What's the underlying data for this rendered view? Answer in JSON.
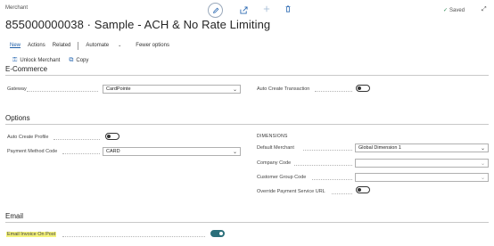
{
  "header": {
    "breadcrumb": "Merchant",
    "title": "855000000038 · Sample - ACH & No Rate Limiting",
    "saved_label": "Saved"
  },
  "icons": {
    "edit": "pencil-icon",
    "share": "share-icon",
    "add": "plus-icon",
    "delete": "trash-icon",
    "saved": "check-icon",
    "expand": "expand-icon"
  },
  "actionbar": {
    "new": "New",
    "actions": "Actions",
    "related": "Related",
    "automate": "Automate",
    "fewer_options": "Fewer options"
  },
  "subactions": {
    "unlock": "Unlock Merchant",
    "copy": "Copy"
  },
  "ecommerce": {
    "title": "E-Commerce",
    "gateway_label": "Gateway",
    "gateway_value": "CardPointe",
    "auto_create_label": "Auto Create Transaction",
    "auto_create_on": false
  },
  "options": {
    "title": "Options",
    "auto_create_profile_label": "Auto Create Profile",
    "auto_create_profile_on": false,
    "payment_method_label": "Payment Method Code",
    "payment_method_value": "CARD",
    "dimensions_title": "DIMENSIONS",
    "default_merchant_label": "Default Merchant",
    "default_merchant_value": "Global Dimension 1",
    "company_code_label": "Company Code",
    "company_code_value": "",
    "customer_group_label": "Customer Group Code",
    "customer_group_value": "",
    "override_label": "Override Payment Service URL",
    "override_on": false
  },
  "email": {
    "title": "Email",
    "invoice_label": "Email Invoice On Post",
    "invoice_on": true
  },
  "colors": {
    "accent": "#2f6cb3",
    "toggle_on": "#2b6f7a",
    "highlight": "#f4f27a"
  }
}
